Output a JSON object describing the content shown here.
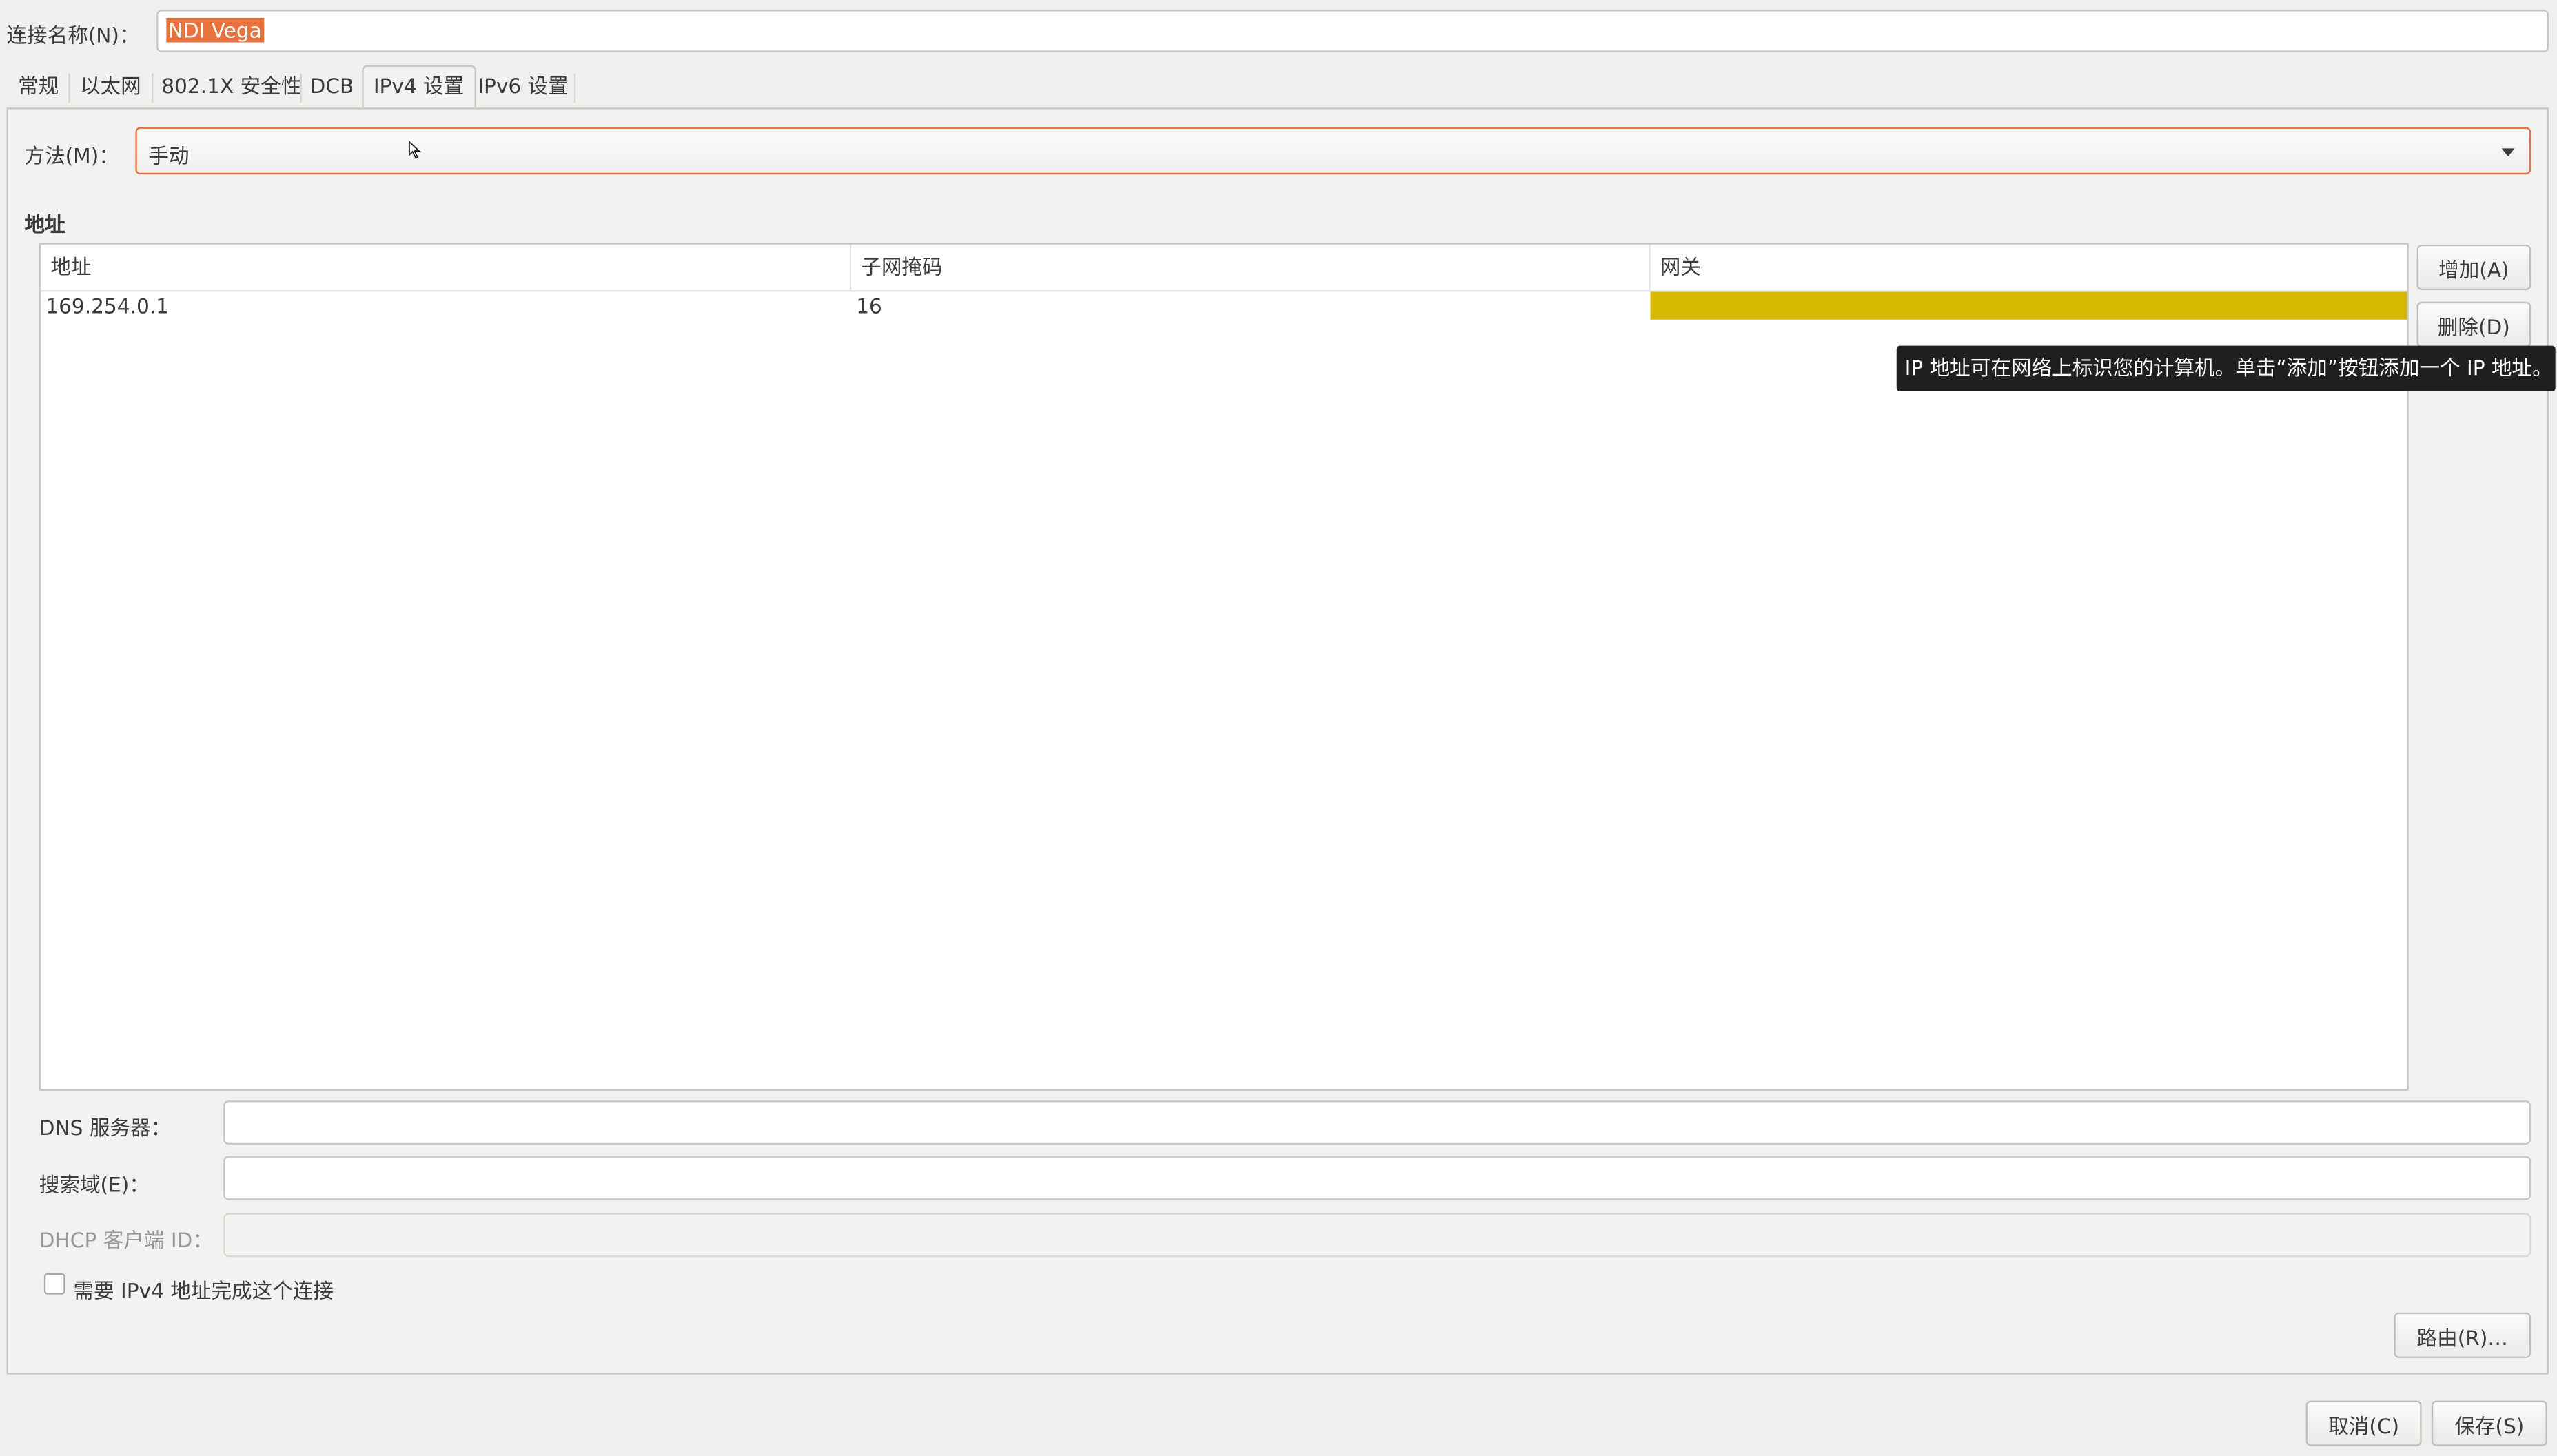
{
  "connection_name": {
    "label": "连接名称(N)：",
    "value": "NDI Vega"
  },
  "tabs": [
    {
      "label": "常规",
      "active": false
    },
    {
      "label": "以太网",
      "active": false
    },
    {
      "label": "802.1X 安全性",
      "active": false
    },
    {
      "label": "DCB",
      "active": false
    },
    {
      "label": "IPv4 设置",
      "active": true
    },
    {
      "label": "IPv6 设置",
      "active": false
    }
  ],
  "ipv4": {
    "method_label": "方法(M)：",
    "method_value": "手动",
    "addresses_heading": "地址",
    "table": {
      "columns": [
        "地址",
        "子网掩码",
        "网关"
      ],
      "rows": [
        {
          "address": "169.254.0.1",
          "netmask": "16",
          "gateway": ""
        }
      ]
    },
    "add_button": "增加(A)",
    "delete_button": "删除(D)",
    "tooltip": "IP 地址可在网络上标识您的计算机。单击“添加”按钮添加一个 IP 地址。",
    "dns_label": "DNS 服务器：",
    "dns_value": "",
    "search_label": "搜索域(E)：",
    "search_value": "",
    "dhcp_label": "DHCP 客户端 ID：",
    "dhcp_value": "",
    "require_ipv4_label": "需要 IPv4 地址完成这个连接",
    "require_ipv4_checked": false,
    "routes_button": "路由(R)…"
  },
  "footer": {
    "cancel_button": "取消(C)",
    "save_button": "保存(S)"
  },
  "colors": {
    "accent": "#e9713c",
    "gateway_cell_highlight": "#d6b700",
    "tooltip_bg": "#202020",
    "window_bg": "#f0efee"
  },
  "icons": {
    "method_dropdown": "chevron-down-icon",
    "pointer": "mouse-cursor-icon"
  }
}
